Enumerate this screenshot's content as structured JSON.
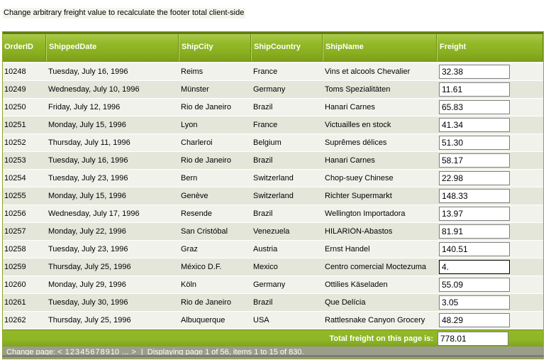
{
  "instruction": "Change arbitrary freight value to recalculate the footer total client-side",
  "columns": [
    "OrderID",
    "ShippedDate",
    "ShipCity",
    "ShipCountry",
    "ShipName",
    "Freight"
  ],
  "rows": [
    {
      "order_id": "10248",
      "shipped_date": "Tuesday, July 16, 1996",
      "city": "Reims",
      "country": "France",
      "name": "Vins et alcools Chevalier",
      "freight": "32.38"
    },
    {
      "order_id": "10249",
      "shipped_date": "Wednesday, July 10, 1996",
      "city": "Münster",
      "country": "Germany",
      "name": "Toms Spezialitäten",
      "freight": "11.61"
    },
    {
      "order_id": "10250",
      "shipped_date": "Friday, July 12, 1996",
      "city": "Rio de Janeiro",
      "country": "Brazil",
      "name": "Hanari Carnes",
      "freight": "65.83"
    },
    {
      "order_id": "10251",
      "shipped_date": "Monday, July 15, 1996",
      "city": "Lyon",
      "country": "France",
      "name": "Victuailles en stock",
      "freight": "41.34"
    },
    {
      "order_id": "10252",
      "shipped_date": "Thursday, July 11, 1996",
      "city": "Charleroi",
      "country": "Belgium",
      "name": "Suprêmes délices",
      "freight": "51.30"
    },
    {
      "order_id": "10253",
      "shipped_date": "Tuesday, July 16, 1996",
      "city": "Rio de Janeiro",
      "country": "Brazil",
      "name": "Hanari Carnes",
      "freight": "58.17"
    },
    {
      "order_id": "10254",
      "shipped_date": "Tuesday, July 23, 1996",
      "city": "Bern",
      "country": "Switzerland",
      "name": "Chop-suey Chinese",
      "freight": "22.98"
    },
    {
      "order_id": "10255",
      "shipped_date": "Monday, July 15, 1996",
      "city": "Genève",
      "country": "Switzerland",
      "name": "Richter Supermarkt",
      "freight": "148.33"
    },
    {
      "order_id": "10256",
      "shipped_date": "Wednesday, July 17, 1996",
      "city": "Resende",
      "country": "Brazil",
      "name": "Wellington Importadora",
      "freight": "13.97"
    },
    {
      "order_id": "10257",
      "shipped_date": "Monday, July 22, 1996",
      "city": "San Cristóbal",
      "country": "Venezuela",
      "name": "HILARIÓN-Abastos",
      "freight": "81.91"
    },
    {
      "order_id": "10258",
      "shipped_date": "Tuesday, July 23, 1996",
      "city": "Graz",
      "country": "Austria",
      "name": "Ernst Handel",
      "freight": "140.51"
    },
    {
      "order_id": "10259",
      "shipped_date": "Thursday, July 25, 1996",
      "city": "México D.F.",
      "country": "Mexico",
      "name": "Centro comercial Moctezuma",
      "freight": "4."
    },
    {
      "order_id": "10260",
      "shipped_date": "Monday, July 29, 1996",
      "city": "Köln",
      "country": "Germany",
      "name": "Ottilies Käseladen",
      "freight": "55.09"
    },
    {
      "order_id": "10261",
      "shipped_date": "Tuesday, July 30, 1996",
      "city": "Rio de Janeiro",
      "country": "Brazil",
      "name": "Que Delícia",
      "freight": "3.05"
    },
    {
      "order_id": "10262",
      "shipped_date": "Thursday, July 25, 1996",
      "city": "Albuquerque",
      "country": "USA",
      "name": "Rattlesnake Canyon Grocery",
      "freight": "48.29"
    }
  ],
  "focused_row_index": 11,
  "footer": {
    "total_label": "Total freight on this page is:",
    "total_value": "778.01"
  },
  "pager": {
    "prefix": "Change page:",
    "prev": "<",
    "pages": [
      "1",
      "2",
      "3",
      "4",
      "5",
      "6",
      "7",
      "8",
      "9",
      "10"
    ],
    "more": "...",
    "next": ">",
    "separator": "|",
    "status": "Displaying page 1 of 56, items 1 to 15 of 830."
  },
  "colors": {
    "header_green": "#93b928",
    "row_odd": "#f2f2ec",
    "row_even": "#e4e6da",
    "pager_bg": "#9b9d8d"
  }
}
